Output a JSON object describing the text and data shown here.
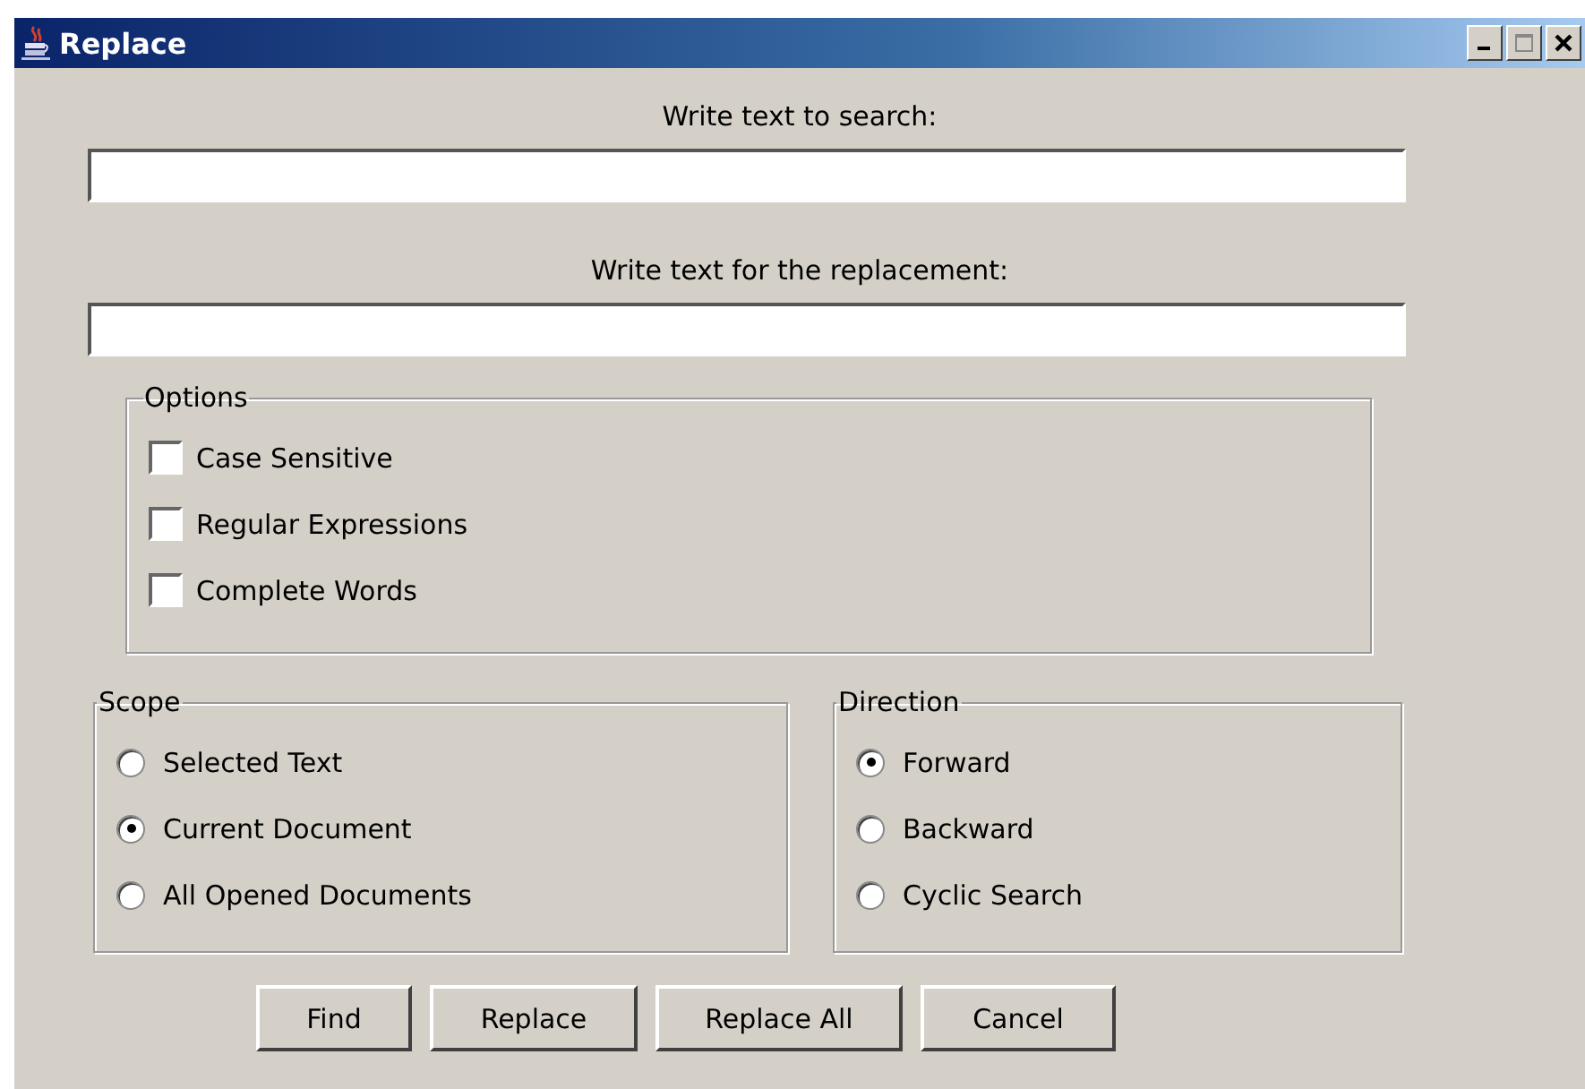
{
  "window": {
    "title": "Replace"
  },
  "search": {
    "label": "Write text to search:"
  },
  "replacement": {
    "label": "Write text for the replacement:"
  },
  "options": {
    "title": "Options",
    "items": [
      {
        "label": "Case Sensitive",
        "checked": false
      },
      {
        "label": "Regular Expressions",
        "checked": false
      },
      {
        "label": "Complete Words",
        "checked": false
      }
    ]
  },
  "scope": {
    "title": "Scope",
    "items": [
      {
        "label": "Selected Text",
        "selected": false
      },
      {
        "label": "Current Document",
        "selected": true
      },
      {
        "label": "All Opened Documents",
        "selected": false
      }
    ]
  },
  "direction": {
    "title": "Direction",
    "items": [
      {
        "label": "Forward",
        "selected": true
      },
      {
        "label": "Backward",
        "selected": false
      },
      {
        "label": "Cyclic Search",
        "selected": false
      }
    ]
  },
  "buttons": [
    "Find",
    "Replace",
    "Replace All",
    "Cancel"
  ]
}
